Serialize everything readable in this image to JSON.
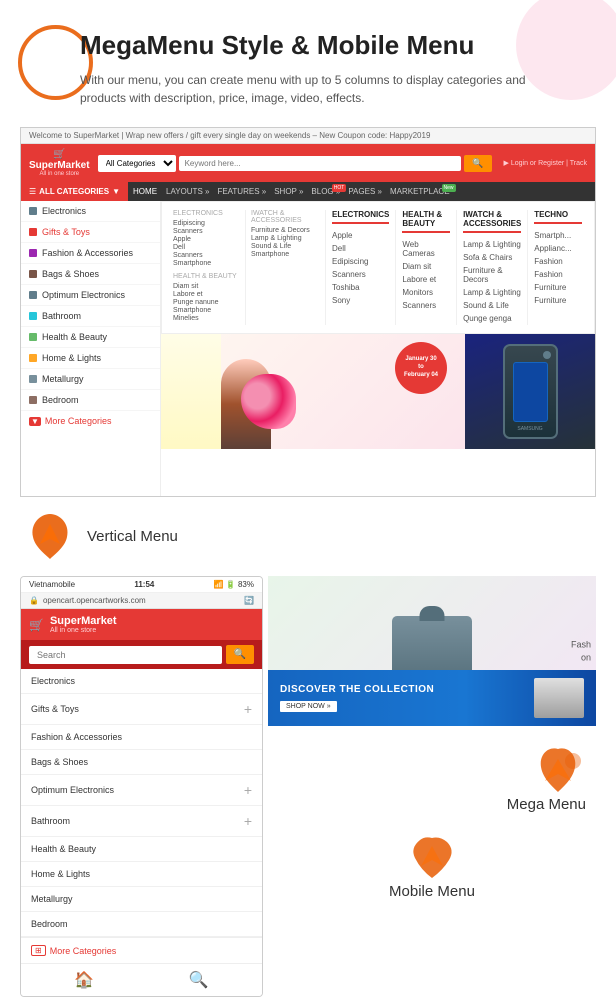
{
  "header": {
    "title": "MegaMenu Style & Mobile Menu",
    "description": "With our menu, you can create menu with up to 5 columns to display categories and products with description, price, image, video, effects."
  },
  "supermarket": {
    "logo": "SuperMarket",
    "logo_sub": "All in one store",
    "topbar_text": "Welcome to SuperMarket | Wrap new offers / gift every single day on weekends – New Coupon code: Happy2019",
    "search_placeholder": "Keyword here...",
    "category_default": "All Categories",
    "nav_items": [
      {
        "label": "HOME",
        "active": true
      },
      {
        "label": "LAYOUTS »"
      },
      {
        "label": "FEATURES »"
      },
      {
        "label": "SHOP »"
      },
      {
        "label": "BLOG »",
        "badge": "HOT"
      },
      {
        "label": "PAGES »"
      },
      {
        "label": "MARKETPLACE",
        "badge": "NEW"
      }
    ],
    "nav_right": "▶ Login or Register | Track",
    "sidebar_items": [
      {
        "label": "Electronics",
        "icon": "electronics"
      },
      {
        "label": "Gifts & Toys",
        "icon": "gifts",
        "color": "#e53935"
      },
      {
        "label": "Fashion & Accessories",
        "icon": "fashion",
        "color": "#9c27b0"
      },
      {
        "label": "Bags & Shoes",
        "icon": "bags",
        "color": "#795548"
      },
      {
        "label": "Optimum Electronics",
        "icon": "optimum"
      },
      {
        "label": "Bathroom",
        "icon": "bathroom"
      },
      {
        "label": "Health & Beauty",
        "icon": "health"
      },
      {
        "label": "Home & Lights",
        "icon": "home"
      },
      {
        "label": "Metallurgy",
        "icon": "metal"
      },
      {
        "label": "Bedroom",
        "icon": "bedroom"
      }
    ],
    "more_categories": "More Categories",
    "mega_menu": {
      "columns": [
        {
          "header": "ELECTRONICS",
          "items": [
            "Apple",
            "Dell",
            "Edipiscing",
            "Scanners",
            "Toshiba",
            "Sony"
          ]
        },
        {
          "header": "HEALTH & BEAUTY",
          "items": [
            "Web Cameras",
            "Diam sit",
            "Labore et",
            "Monitors",
            "Scanners"
          ]
        },
        {
          "header": "IWATCH & ACCESSORIES",
          "items": [
            "Lamp & Lighting",
            "Sofa & Chairs",
            "Furniture & Decors",
            "Lamp & Lighting",
            "Sound & Life",
            "Qunge genga"
          ]
        },
        {
          "header": "TECHNO",
          "items": [
            "Smartph...",
            "Applianc...",
            "Fashion",
            "Fashion",
            "Furniture",
            "Furniture"
          ]
        }
      ]
    },
    "promo_badge_line1": "January 30",
    "promo_badge_line2": "to",
    "promo_badge_line3": "February 04"
  },
  "vertical_menu": {
    "label": "Vertical Menu"
  },
  "mega_menu_label": {
    "label": "Mega Menu"
  },
  "mobile_menu_label": {
    "label": "Mobile Menu"
  },
  "mobile": {
    "carrier": "Vietnamobile",
    "time": "11:54",
    "battery": "83%",
    "url": "opencart.opencartworks.com",
    "logo": "SuperMarket",
    "logo_sub": "All in one store",
    "search_placeholder": "Search",
    "menu_items": [
      {
        "label": "Electronics",
        "has_plus": false
      },
      {
        "label": "Gifts & Toys",
        "has_plus": true
      },
      {
        "label": "Fashion & Accessories",
        "has_plus": false
      },
      {
        "label": "Bags & Shoes",
        "has_plus": false
      },
      {
        "label": "Optimum Electronics",
        "has_plus": true
      },
      {
        "label": "Bathroom",
        "has_plus": true
      },
      {
        "label": "Health & Beauty",
        "has_plus": false
      },
      {
        "label": "Home & Lights",
        "has_plus": false
      },
      {
        "label": "Metallurgy",
        "has_plus": false
      },
      {
        "label": "Bedroom",
        "has_plus": false
      }
    ],
    "more_categories": "More Categories"
  },
  "discover_banner": {
    "title": "DISCOVER THE COLLECTION",
    "button": "SHOP NOW »"
  }
}
